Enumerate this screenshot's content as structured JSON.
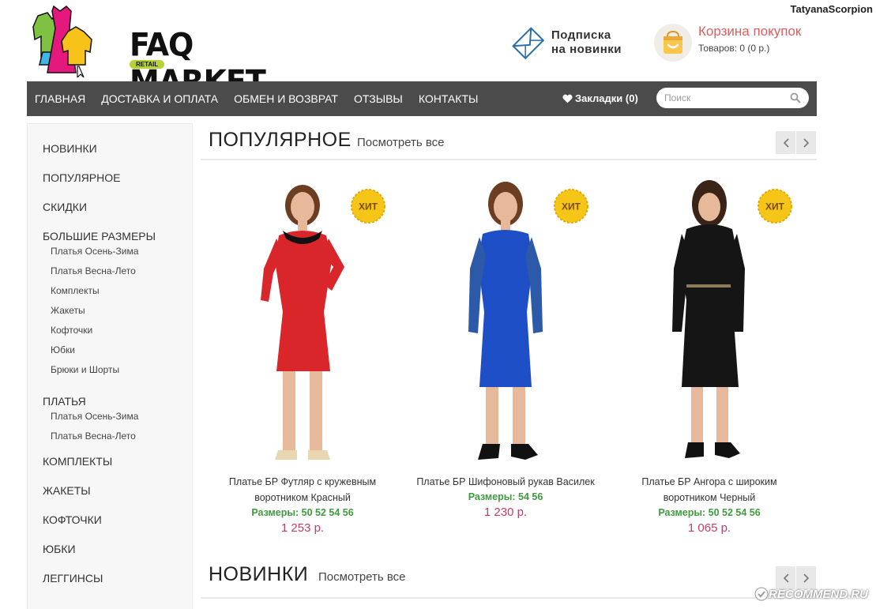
{
  "user": {
    "name": "TatyanaScorpion"
  },
  "header": {
    "logo_text": "FAQ MARKET",
    "logo_sub": "RETAIL",
    "subscribe": {
      "line1": "Подписка",
      "line2": "на новинки"
    },
    "cart": {
      "title": "Корзина покупок",
      "count": "Товаров: 0 (0 р.)"
    }
  },
  "nav": {
    "items": [
      {
        "label": "ГЛАВНАЯ"
      },
      {
        "label": "ДОСТАВКА И ОПЛАТА"
      },
      {
        "label": "ОБМЕН И ВОЗВРАТ"
      },
      {
        "label": "ОТЗЫВЫ"
      },
      {
        "label": "КОНТАКТЫ"
      }
    ],
    "bookmarks": "Закладки (0)",
    "search_placeholder": "Поиск"
  },
  "sidebar": {
    "items": [
      {
        "label": "НОВИНКИ"
      },
      {
        "label": "ПОПУЛЯРНОЕ"
      },
      {
        "label": "СКИДКИ"
      },
      {
        "label": "БОЛЬШИЕ РАЗМЕРЫ"
      },
      {
        "label": "Платья Осень-Зима"
      },
      {
        "label": "Платья Весна-Лето"
      },
      {
        "label": "Комплекты"
      },
      {
        "label": "Жакеты"
      },
      {
        "label": "Кофточки"
      },
      {
        "label": "Юбки"
      },
      {
        "label": "Брюки и Шорты"
      },
      {
        "label": "ПЛАТЬЯ"
      },
      {
        "label": "Платья Осень-Зима"
      },
      {
        "label": "Платья Весна-Лето"
      },
      {
        "label": "КОМПЛЕКТЫ"
      },
      {
        "label": "ЖАКЕТЫ"
      },
      {
        "label": "КОФТОЧКИ"
      },
      {
        "label": "ЮБКИ"
      },
      {
        "label": "ЛЕГГИНСЫ"
      }
    ]
  },
  "sections": {
    "popular": {
      "title": "ПОПУЛЯРНОЕ",
      "link": "Посмотреть все"
    },
    "new": {
      "title": "НОВИНКИ",
      "link": "Посмотреть все"
    }
  },
  "products": [
    {
      "badge": "ХИТ",
      "name_line1": "Платье БР Футляр с кружевным",
      "name_line2": "воротником Красный",
      "sizes": "Размеры: 50 52 54 56",
      "price": "1 253 р.",
      "dress_color": "#d8262b",
      "dress_icon": "red-dress-photo"
    },
    {
      "badge": "ХИТ",
      "name_line1": "Платье БР Шифоновый рукав Василек",
      "name_line2": "",
      "sizes": "Размеры: 54 56",
      "price": "1 230 р.",
      "dress_color": "#1e4fc6",
      "dress_icon": "blue-dress-photo"
    },
    {
      "badge": "ХИТ",
      "name_line1": "Платье БР Ангора с широким",
      "name_line2": "воротником Черный",
      "sizes": "Размеры: 50 52 54 56",
      "price": "1 065 р.",
      "dress_color": "#151515",
      "dress_icon": "black-dress-photo"
    }
  ],
  "colors": {
    "nav_bg": "#4b4b4b",
    "cart_title": "#e05d5d",
    "sizes": "#3e9b3e",
    "price": "#c63b6a",
    "badge": "#f5c518"
  },
  "watermark": "RECOMMEND.RU"
}
